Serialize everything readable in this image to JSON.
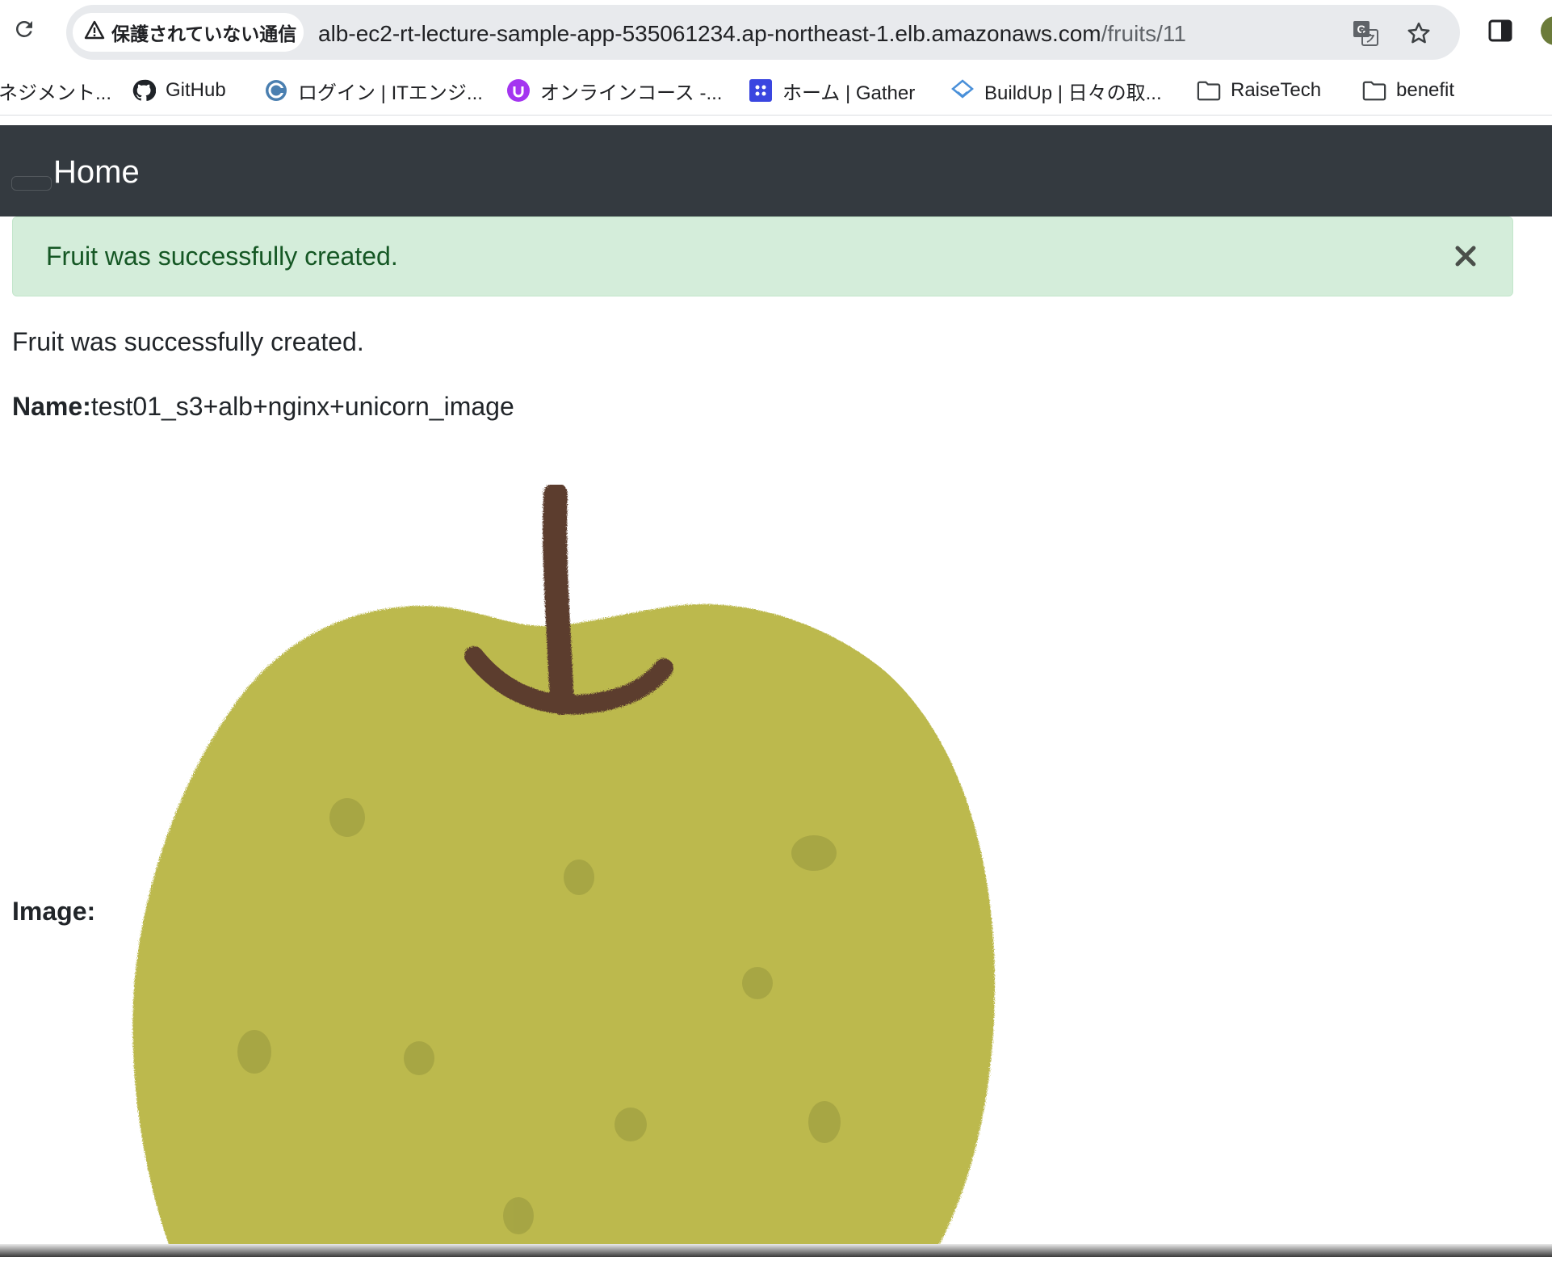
{
  "browser": {
    "security_label": "保護されていない通信",
    "url_host": "alb-ec2-rt-lecture-sample-app-535061234.ap-northeast-1.elb.amazonaws.com",
    "url_path": "/fruits/11",
    "icons": {
      "reload": "reload-icon",
      "warning": "warning-triangle-icon",
      "translate": "translate-icon",
      "bookmark_star": "star-icon",
      "side_panel": "side-panel-icon"
    }
  },
  "bookmarks": [
    {
      "label": "ネジメント...",
      "icon": "none"
    },
    {
      "label": "GitHub",
      "icon": "github-icon"
    },
    {
      "label": "ログイン | ITエンジ...",
      "icon": "site-icon"
    },
    {
      "label": "オンラインコース -...",
      "icon": "udemy-icon"
    },
    {
      "label": "ホーム | Gather",
      "icon": "gather-icon"
    },
    {
      "label": "BuildUp | 日々の取...",
      "icon": "buildup-icon"
    },
    {
      "label": "RaiseTech",
      "icon": "folder-icon"
    },
    {
      "label": "benefit",
      "icon": "folder-icon"
    }
  ],
  "navbar": {
    "brand": "Home"
  },
  "alert": {
    "message": "Fruit was successfully created.",
    "close_symbol": "×"
  },
  "page": {
    "notice": "Fruit was successfully created.",
    "name_label": "Name:",
    "name_value": "test01_s3+alb+nginx+unicorn_image",
    "image_label": "Image:"
  },
  "colors": {
    "navbar_bg": "#343a40",
    "alert_bg": "#d4edda",
    "alert_text": "#155724",
    "pear_body": "#bcb94d",
    "pear_stem": "#5c3d2e"
  }
}
